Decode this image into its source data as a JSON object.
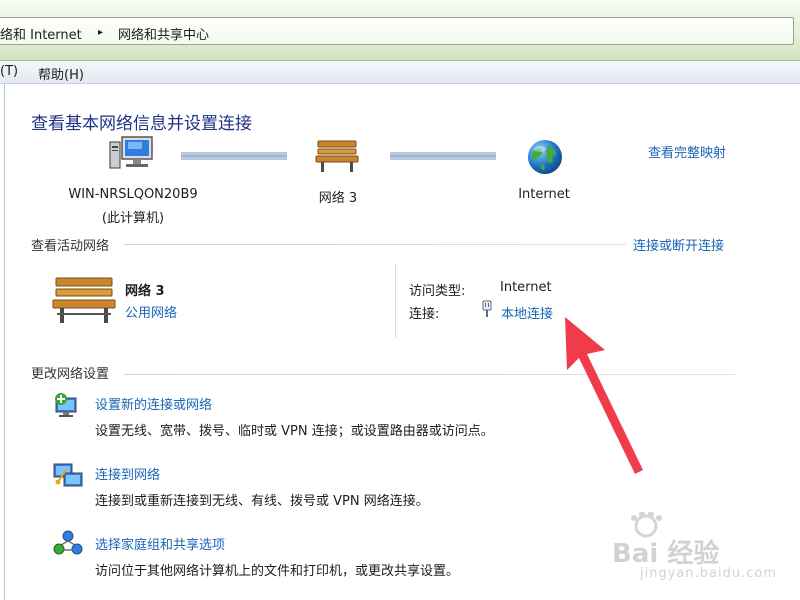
{
  "breadcrumb": {
    "parent": "络和 Internet",
    "separator": "▸",
    "current": "网络和共享中心"
  },
  "menu": {
    "tools": "(T)",
    "help": "帮助(H)"
  },
  "main": {
    "title": "查看基本网络信息并设置连接",
    "full_map_link": "查看完整映射",
    "map": {
      "computer_name": "WIN-NRSLQON20B9",
      "computer_sub": "(此计算机)",
      "network_name": "网络  3",
      "internet_name": "Internet"
    },
    "active": {
      "section_title": "查看活动网络",
      "connect_link": "连接或断开连接",
      "network_name": "网络  3",
      "network_type": "公用网络",
      "access_type_label": "访问类型:",
      "access_type_value": "Internet",
      "connection_label": "连接:",
      "connection_value": "本地连接"
    },
    "change": {
      "section_title": "更改网络设置",
      "items": [
        {
          "label": "设置新的连接或网络",
          "desc": "设置无线、宽带、拨号、临时或 VPN 连接；或设置路由器或访问点。"
        },
        {
          "label": "连接到网络",
          "desc": "连接到或重新连接到无线、有线、拨号或 VPN 网络连接。"
        },
        {
          "label": "选择家庭组和共享选项",
          "desc": "访问位于其他网络计算机上的文件和打印机，或更改共享设置。"
        }
      ]
    }
  },
  "watermark": {
    "brand": "Bai  经验",
    "url": "jingyan.baidu.com"
  },
  "colors": {
    "title": "#1e3287",
    "link": "#1a65b5",
    "arrow": "#f03c4a"
  }
}
